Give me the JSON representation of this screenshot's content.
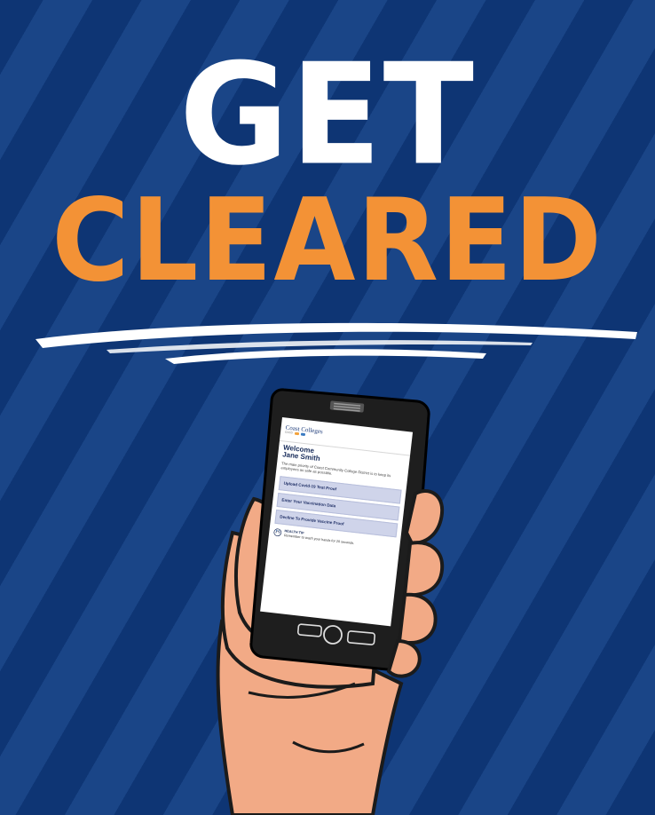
{
  "poster": {
    "headline_line1": "GET",
    "headline_line2": "CLEARED",
    "colors": {
      "background": "#0e3574",
      "stripe": "#1a4587",
      "headline_white": "#ffffff",
      "headline_orange": "#f39236",
      "skin": "#f2aa86",
      "phone_body": "#1e1e1e"
    }
  },
  "app": {
    "logo_text": "Coast Colleges",
    "logo_sub": "CCCD",
    "welcome_label": "Welcome",
    "user_name": "Jane Smith",
    "intro_text": "The main priority of Coast Community College District is to keep its employees as safe as possible.",
    "buttons": [
      {
        "label": "Upload Covid-19 Test Proof"
      },
      {
        "label": "Enter Your Vaccination Data"
      },
      {
        "label": "Decline To Provide Vaccine Proof"
      }
    ],
    "tip_title": "HEALTH TIP",
    "tip_text": "Remember to wash your hands for 20 seconds."
  }
}
